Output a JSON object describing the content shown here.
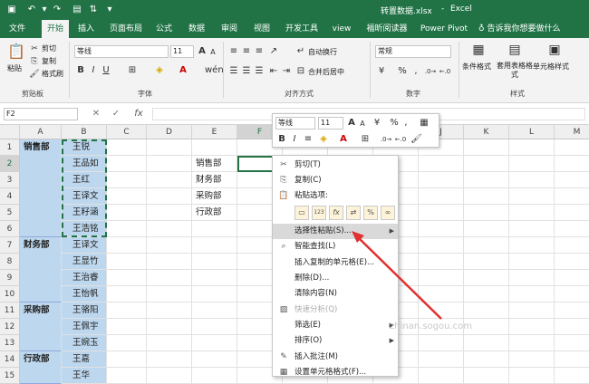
{
  "title": {
    "filename": "转置数据.xlsx",
    "app": "Excel"
  },
  "tabs": [
    "文件",
    "开始",
    "插入",
    "页面布局",
    "公式",
    "数据",
    "审阅",
    "视图",
    "开发工具",
    "view",
    "福昕阅读器",
    "Power Pivot"
  ],
  "tell_me": "告诉我你想要做什么",
  "ribbon": {
    "groups": {
      "clipboard": "剪贴板",
      "font": "字体",
      "align": "对齐方式",
      "number": "数字",
      "styles": "样式"
    },
    "paste": "粘贴",
    "cut": "剪切",
    "copy": "复制",
    "format_painter": "格式刷",
    "font_name": "等线",
    "font_size": "11",
    "wrap": "自动换行",
    "merge": "合并后居中",
    "number_format": "常规",
    "cond_format": "条件格式",
    "table_format": "套用表格格式",
    "cell_style": "单元格样式",
    "bold": "B",
    "italic": "I",
    "underline": "U",
    "grow": "A",
    "shrink": "A",
    "percent": "%",
    "comma": ","
  },
  "formula": {
    "name_box": "F2",
    "fx": "fx"
  },
  "columns": [
    "A",
    "B",
    "C",
    "D",
    "E",
    "F",
    "G",
    "H",
    "I",
    "J",
    "K",
    "L",
    "M"
  ],
  "rows": [
    "1",
    "2",
    "3",
    "4",
    "5",
    "6",
    "7",
    "8",
    "9",
    "10",
    "11",
    "12",
    "13",
    "14",
    "15"
  ],
  "col_a": [
    {
      "row": 0,
      "span": 6,
      "text": "销售部"
    },
    {
      "row": 6,
      "span": 4,
      "text": "财务部"
    },
    {
      "row": 10,
      "span": 3,
      "text": "采购部"
    },
    {
      "row": 13,
      "span": 2,
      "text": "行政部"
    }
  ],
  "col_b": [
    "王锐",
    "王品如",
    "王红",
    "王译文",
    "王籽涵",
    "王浩铭",
    "王译文",
    "王显竹",
    "王治睿",
    "王怡帆",
    "王骆阳",
    "王佩宇",
    "王婉玉",
    "王嘉",
    "王华"
  ],
  "col_e": [
    "销售部",
    "财务部",
    "采购部",
    "行政部"
  ],
  "mini_toolbar": {
    "font_name": "等线",
    "font_size": "11",
    "bold": "B",
    "italic": "I"
  },
  "context_menu": {
    "cut": "剪切(T)",
    "copy": "复制(C)",
    "paste_options": "粘贴选项:",
    "paste_special": "选择性粘贴(S)...",
    "smart_lookup": "智能查找(L)",
    "insert_copied": "插入复制的单元格(E)...",
    "delete": "删除(D)...",
    "clear": "清除内容(N)",
    "quick_analysis": "快速分析(Q)",
    "filter": "筛选(E)",
    "sort": "排序(O)",
    "insert_comment": "插入批注(M)",
    "format_cells": "设置单元格格式(F)..."
  },
  "watermark": "zhinan.sogou.com",
  "colors": {
    "excel_green": "#217346",
    "selection_blue": "#bdd7ee",
    "arrow_red": "#e03030"
  }
}
